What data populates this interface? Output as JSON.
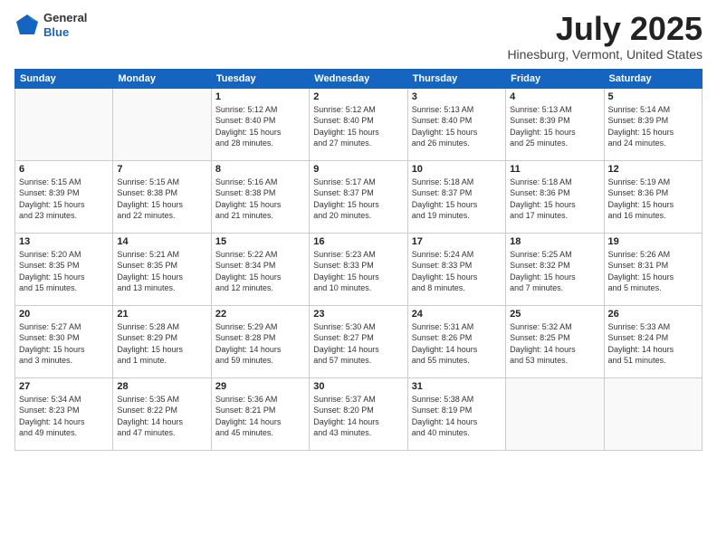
{
  "logo": {
    "general": "General",
    "blue": "Blue"
  },
  "header": {
    "title": "July 2025",
    "subtitle": "Hinesburg, Vermont, United States"
  },
  "weekdays": [
    "Sunday",
    "Monday",
    "Tuesday",
    "Wednesday",
    "Thursday",
    "Friday",
    "Saturday"
  ],
  "weeks": [
    [
      {
        "day": "",
        "detail": ""
      },
      {
        "day": "",
        "detail": ""
      },
      {
        "day": "1",
        "detail": "Sunrise: 5:12 AM\nSunset: 8:40 PM\nDaylight: 15 hours\nand 28 minutes."
      },
      {
        "day": "2",
        "detail": "Sunrise: 5:12 AM\nSunset: 8:40 PM\nDaylight: 15 hours\nand 27 minutes."
      },
      {
        "day": "3",
        "detail": "Sunrise: 5:13 AM\nSunset: 8:40 PM\nDaylight: 15 hours\nand 26 minutes."
      },
      {
        "day": "4",
        "detail": "Sunrise: 5:13 AM\nSunset: 8:39 PM\nDaylight: 15 hours\nand 25 minutes."
      },
      {
        "day": "5",
        "detail": "Sunrise: 5:14 AM\nSunset: 8:39 PM\nDaylight: 15 hours\nand 24 minutes."
      }
    ],
    [
      {
        "day": "6",
        "detail": "Sunrise: 5:15 AM\nSunset: 8:39 PM\nDaylight: 15 hours\nand 23 minutes."
      },
      {
        "day": "7",
        "detail": "Sunrise: 5:15 AM\nSunset: 8:38 PM\nDaylight: 15 hours\nand 22 minutes."
      },
      {
        "day": "8",
        "detail": "Sunrise: 5:16 AM\nSunset: 8:38 PM\nDaylight: 15 hours\nand 21 minutes."
      },
      {
        "day": "9",
        "detail": "Sunrise: 5:17 AM\nSunset: 8:37 PM\nDaylight: 15 hours\nand 20 minutes."
      },
      {
        "day": "10",
        "detail": "Sunrise: 5:18 AM\nSunset: 8:37 PM\nDaylight: 15 hours\nand 19 minutes."
      },
      {
        "day": "11",
        "detail": "Sunrise: 5:18 AM\nSunset: 8:36 PM\nDaylight: 15 hours\nand 17 minutes."
      },
      {
        "day": "12",
        "detail": "Sunrise: 5:19 AM\nSunset: 8:36 PM\nDaylight: 15 hours\nand 16 minutes."
      }
    ],
    [
      {
        "day": "13",
        "detail": "Sunrise: 5:20 AM\nSunset: 8:35 PM\nDaylight: 15 hours\nand 15 minutes."
      },
      {
        "day": "14",
        "detail": "Sunrise: 5:21 AM\nSunset: 8:35 PM\nDaylight: 15 hours\nand 13 minutes."
      },
      {
        "day": "15",
        "detail": "Sunrise: 5:22 AM\nSunset: 8:34 PM\nDaylight: 15 hours\nand 12 minutes."
      },
      {
        "day": "16",
        "detail": "Sunrise: 5:23 AM\nSunset: 8:33 PM\nDaylight: 15 hours\nand 10 minutes."
      },
      {
        "day": "17",
        "detail": "Sunrise: 5:24 AM\nSunset: 8:33 PM\nDaylight: 15 hours\nand 8 minutes."
      },
      {
        "day": "18",
        "detail": "Sunrise: 5:25 AM\nSunset: 8:32 PM\nDaylight: 15 hours\nand 7 minutes."
      },
      {
        "day": "19",
        "detail": "Sunrise: 5:26 AM\nSunset: 8:31 PM\nDaylight: 15 hours\nand 5 minutes."
      }
    ],
    [
      {
        "day": "20",
        "detail": "Sunrise: 5:27 AM\nSunset: 8:30 PM\nDaylight: 15 hours\nand 3 minutes."
      },
      {
        "day": "21",
        "detail": "Sunrise: 5:28 AM\nSunset: 8:29 PM\nDaylight: 15 hours\nand 1 minute."
      },
      {
        "day": "22",
        "detail": "Sunrise: 5:29 AM\nSunset: 8:28 PM\nDaylight: 14 hours\nand 59 minutes."
      },
      {
        "day": "23",
        "detail": "Sunrise: 5:30 AM\nSunset: 8:27 PM\nDaylight: 14 hours\nand 57 minutes."
      },
      {
        "day": "24",
        "detail": "Sunrise: 5:31 AM\nSunset: 8:26 PM\nDaylight: 14 hours\nand 55 minutes."
      },
      {
        "day": "25",
        "detail": "Sunrise: 5:32 AM\nSunset: 8:25 PM\nDaylight: 14 hours\nand 53 minutes."
      },
      {
        "day": "26",
        "detail": "Sunrise: 5:33 AM\nSunset: 8:24 PM\nDaylight: 14 hours\nand 51 minutes."
      }
    ],
    [
      {
        "day": "27",
        "detail": "Sunrise: 5:34 AM\nSunset: 8:23 PM\nDaylight: 14 hours\nand 49 minutes."
      },
      {
        "day": "28",
        "detail": "Sunrise: 5:35 AM\nSunset: 8:22 PM\nDaylight: 14 hours\nand 47 minutes."
      },
      {
        "day": "29",
        "detail": "Sunrise: 5:36 AM\nSunset: 8:21 PM\nDaylight: 14 hours\nand 45 minutes."
      },
      {
        "day": "30",
        "detail": "Sunrise: 5:37 AM\nSunset: 8:20 PM\nDaylight: 14 hours\nand 43 minutes."
      },
      {
        "day": "31",
        "detail": "Sunrise: 5:38 AM\nSunset: 8:19 PM\nDaylight: 14 hours\nand 40 minutes."
      },
      {
        "day": "",
        "detail": ""
      },
      {
        "day": "",
        "detail": ""
      }
    ]
  ]
}
